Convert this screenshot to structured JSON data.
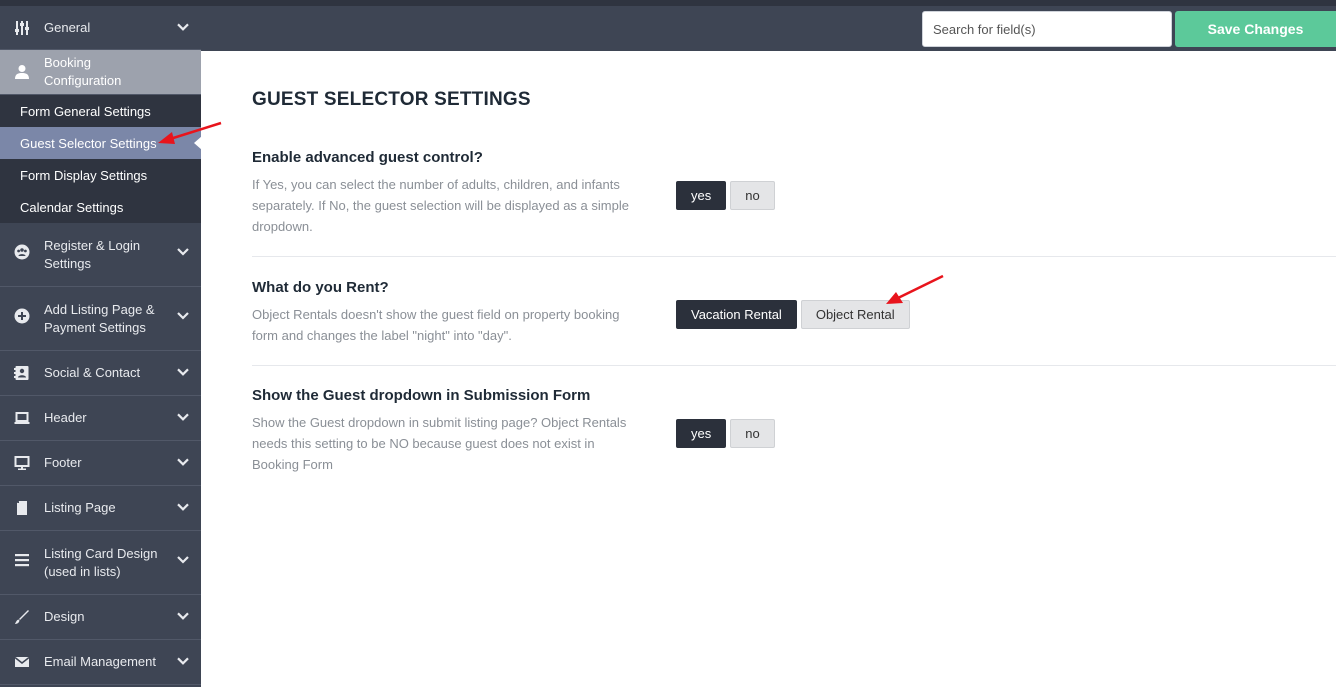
{
  "colors": {
    "sidebar_bg": "#3e4554",
    "sidebar_sub_bg": "#2f3440",
    "sidebar_active": "#9da2ad",
    "sidebar_selected": "#7b87a8",
    "save_green": "#5cc99a",
    "button_dark": "#2b303b",
    "annotation_arrow": "#e8141c"
  },
  "sidebar": {
    "items": [
      {
        "label": "General",
        "icon": "sliders-icon"
      },
      {
        "label": "Booking Configuration",
        "icon": "user-icon",
        "active": true,
        "subitems": [
          {
            "label": "Form General Settings"
          },
          {
            "label": "Guest Selector Settings",
            "selected": true
          },
          {
            "label": "Form Display Settings"
          },
          {
            "label": "Calendar Settings"
          }
        ]
      },
      {
        "label": "Register & Login Settings",
        "icon": "users-icon"
      },
      {
        "label": "Add Listing Page & Payment Settings",
        "icon": "plus-circle-icon"
      },
      {
        "label": "Social & Contact",
        "icon": "contact-card-icon"
      },
      {
        "label": "Header",
        "icon": "laptop-icon"
      },
      {
        "label": "Footer",
        "icon": "desktop-icon"
      },
      {
        "label": "Listing Page",
        "icon": "page-icon"
      },
      {
        "label": "Listing Card Design (used in lists)",
        "icon": "list-icon"
      },
      {
        "label": "Design",
        "icon": "brush-icon"
      },
      {
        "label": "Email Management",
        "icon": "envelope-icon"
      }
    ]
  },
  "header": {
    "search_placeholder": "Search for field(s)",
    "save_label": "Save Changes"
  },
  "main": {
    "title": "GUEST SELECTOR SETTINGS",
    "settings": [
      {
        "title": "Enable advanced guest control?",
        "description": "If Yes, you can select the number of adults, children, and infants separately. If No, the guest selection will be displayed as a simple dropdown.",
        "options": [
          "yes",
          "no"
        ],
        "selected": "yes"
      },
      {
        "title": "What do you Rent?",
        "description": "Object Rentals doesn't show the guest field on property booking form and changes the label \"night\" into \"day\".",
        "options": [
          "Vacation Rental",
          "Object Rental"
        ],
        "selected": "Vacation Rental"
      },
      {
        "title": "Show the Guest dropdown in Submission Form",
        "description": "Show the Guest dropdown in submit listing page? Object Rentals needs this setting to be NO because guest does not exist in Booking Form",
        "options": [
          "yes",
          "no"
        ],
        "selected": "yes"
      }
    ]
  }
}
